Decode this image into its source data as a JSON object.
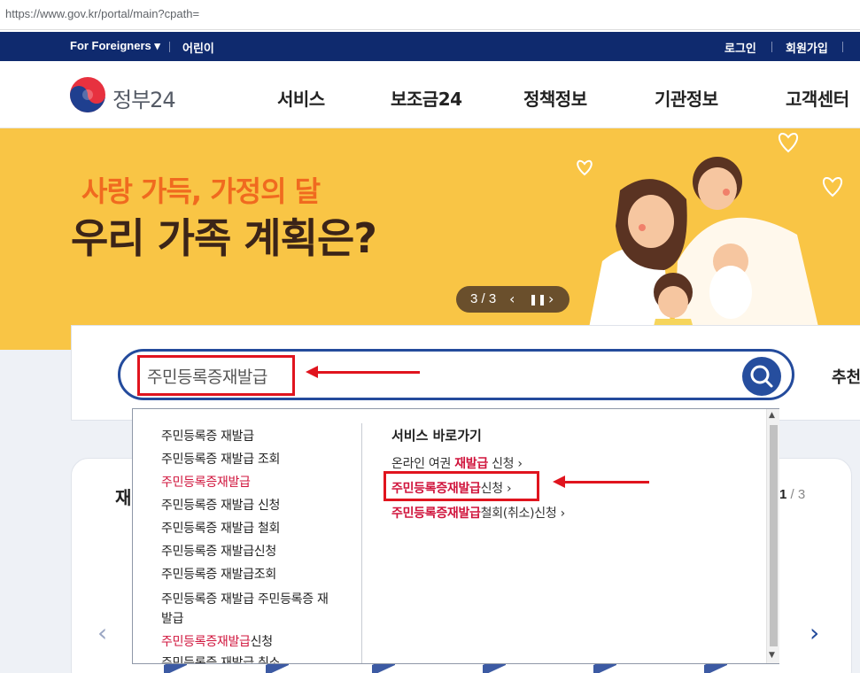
{
  "browser": {
    "url": "https://www.gov.kr/portal/main?cpath="
  },
  "topbar": {
    "foreigners": "For Foreigners ▾",
    "kids": "어린이",
    "login": "로그인",
    "signup": "회원가입"
  },
  "nav": {
    "logo": "정부24",
    "menu": [
      "서비스",
      "보조금24",
      "정책정보",
      "기관정보",
      "고객센터"
    ]
  },
  "banner": {
    "subtitle": "사랑 가득, 가정의 달",
    "title": "우리 가족 계획은?",
    "pager": "3 / 3"
  },
  "search": {
    "value": "주민등록증재발급",
    "recommend_label": "추천"
  },
  "dropdown": {
    "suggestions": [
      "주민등록증 재발급",
      "주민등록증 재발급 조회",
      "주민등록증재발급",
      "주민등록증 재발급 신청",
      "주민등록증 재발급 철회",
      "주민등록증 재발급신청",
      "주민등록증 재발급조회",
      "주민등록증 재발급 주민등록증 재",
      "발급",
      "주민등록증재발급신청",
      "주민등록증 재발급 취소"
    ],
    "suggestion_parts": {
      "s2_hl": "주민등록증재발급",
      "s9_hl": "주민등록증재발급",
      "s9_rest": "신청"
    },
    "services_title": "서비스 바로가기",
    "services": [
      {
        "prefix": "온라인 여권 ",
        "highlight": "재발급",
        "suffix": " 신청 ›"
      },
      {
        "prefix": "",
        "highlight": "주민등록증재발급",
        "suffix": "신청 ›"
      },
      {
        "prefix": "",
        "highlight": "주민등록증재발급",
        "suffix": "철회(취소)신청 ›"
      }
    ]
  },
  "lower": {
    "title": "재",
    "count_current": "1",
    "count_total": " / 3"
  },
  "colors": {
    "navy": "#0f2a6e",
    "banner": "#f9c545",
    "highlight": "#d0143c",
    "annotation": "#e0141e"
  }
}
